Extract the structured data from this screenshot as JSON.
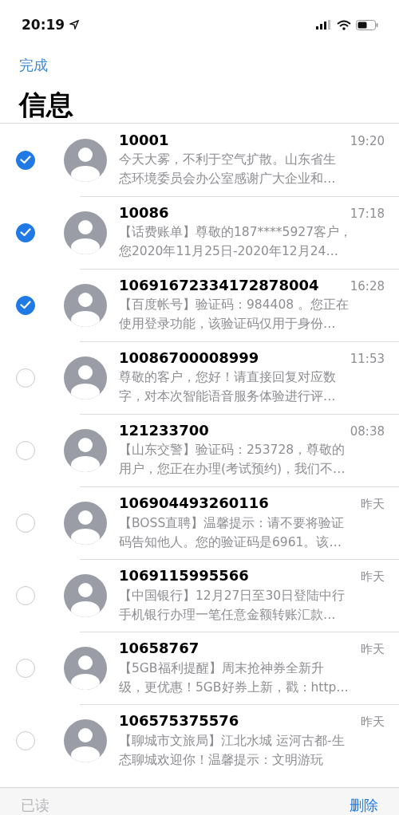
{
  "status_bar": {
    "time": "20:19"
  },
  "nav": {
    "done": "完成",
    "title": "信息"
  },
  "conversations": [
    {
      "sender": "10001",
      "time": "19:20",
      "preview_lines": [
        "今天大雾，不利于空气扩散。山东省生",
        "态环境委员会办公室感谢广大企业和…"
      ],
      "selected": true
    },
    {
      "sender": "10086",
      "time": "17:18",
      "preview_lines": [
        "【话费账单】尊敬的187****5927客户，",
        "您2020年11月25日-2020年12月24…"
      ],
      "selected": true
    },
    {
      "sender": "10691672334172878004",
      "time": "16:28",
      "preview_lines": [
        "【百度帐号】验证码：984408 。您正在",
        "使用登录功能，该验证码仅用于身份…"
      ],
      "selected": true
    },
    {
      "sender": "10086700008999",
      "time": "11:53",
      "preview_lines": [
        "尊敬的客户，您好！请直接回复对应数",
        "字，对本次智能语音服务体验进行评…"
      ],
      "selected": false
    },
    {
      "sender": "121233700",
      "time": "08:38",
      "preview_lines": [
        "【山东交警】验证码：253728，尊敬的",
        "用户，您正在办理(考试预约)，我们不…"
      ],
      "selected": false
    },
    {
      "sender": "106904493260116",
      "time": "昨天",
      "preview_lines": [
        "【BOSS直聘】温馨提示：请不要将验证",
        "码告知他人。您的验证码是6961。该…"
      ],
      "selected": false
    },
    {
      "sender": "1069115995566",
      "time": "昨天",
      "preview_lines": [
        "【中国银行】12月27日至30日登陆中行",
        "手机银行办理一笔任意金额转账汇款…"
      ],
      "selected": false
    },
    {
      "sender": "10658767",
      "time": "昨天",
      "preview_lines": [
        "【5GB福利提醒】周末抢神券全新升",
        "级，更优惠！5GB好券上新，戳：http…"
      ],
      "selected": false
    },
    {
      "sender": "106575375576",
      "time": "昨天",
      "preview_lines": [
        "【聊城市文旅局】江北水城 运河古都-生",
        "态聊城欢迎你！温馨提示：文明游玩"
      ],
      "selected": false
    }
  ],
  "toolbar": {
    "mark_read": {
      "label": "已读",
      "disabled": true
    },
    "delete": {
      "label": "删除",
      "disabled": false
    }
  }
}
